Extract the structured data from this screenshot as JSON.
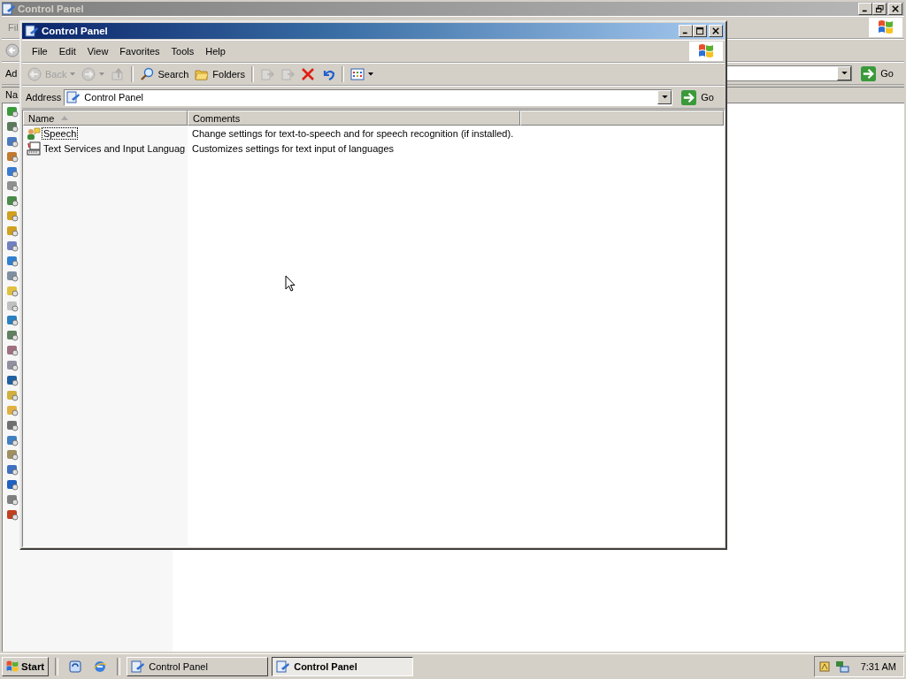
{
  "background_window": {
    "title": "Control Panel",
    "menu_fragment": "Fil",
    "address_fragment": "Ad",
    "column_fragment": "Na",
    "go_label": "Go"
  },
  "window": {
    "title": "Control Panel",
    "menus": [
      "File",
      "Edit",
      "View",
      "Favorites",
      "Tools",
      "Help"
    ],
    "toolbar": [
      {
        "kind": "back",
        "label": "Back",
        "disabled": true,
        "dropdown": true
      },
      {
        "kind": "forward",
        "disabled": true,
        "dropdown": true
      },
      {
        "kind": "up",
        "disabled": true,
        "dropdown": false
      },
      {
        "kind": "separator"
      },
      {
        "kind": "search",
        "label": "Search",
        "disabled": false,
        "dropdown": false
      },
      {
        "kind": "folders",
        "label": "Folders",
        "disabled": false,
        "dropdown": false
      },
      {
        "kind": "separator"
      },
      {
        "kind": "move",
        "disabled": true,
        "dropdown": false
      },
      {
        "kind": "copy",
        "disabled": true,
        "dropdown": false
      },
      {
        "kind": "delete",
        "disabled": false,
        "dropdown": false
      },
      {
        "kind": "undo",
        "disabled": false,
        "dropdown": false
      },
      {
        "kind": "separator"
      },
      {
        "kind": "views",
        "disabled": false,
        "dropdown": true
      }
    ],
    "address": {
      "label": "Address",
      "value": "Control Panel",
      "go_label": "Go"
    },
    "columns": [
      {
        "label": "Name",
        "sorted": true
      },
      {
        "label": "Comments",
        "sorted": false
      },
      {
        "sorted": false
      }
    ],
    "rows": [
      {
        "kind": "speech",
        "name": "Speech",
        "comment": "Change settings for text-to-speech and for speech recognition (if installed).",
        "focused": true
      },
      {
        "kind": "text_services",
        "name": "Text Services and Input Languag",
        "comment": "Customizes settings for text input of languages",
        "focused": false
      }
    ]
  },
  "taskbar": {
    "start_label": "Start",
    "tasks": [
      {
        "label": "Control Panel",
        "selected": false
      },
      {
        "label": "Control Panel",
        "selected": true
      }
    ],
    "clock": "7:31 AM"
  }
}
